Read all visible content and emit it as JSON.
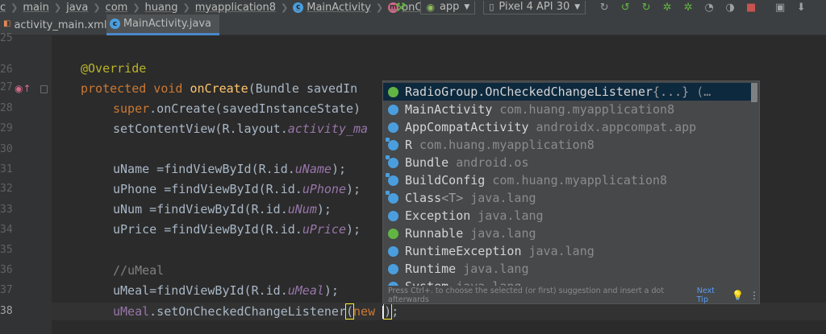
{
  "breadcrumb": [
    "c",
    "main",
    "java",
    "com",
    "huang",
    "myapplication8",
    "MainActivity",
    "onCreate"
  ],
  "toolbar": {
    "run_config": "app",
    "device": "Pixel 4 API 30",
    "icons": [
      "hammer-icon",
      "android-icon",
      "device-icon",
      "run-icon",
      "rerun-icon",
      "apply-changes-icon",
      "debug-icon",
      "attach-debugger-icon",
      "profile-icon",
      "coverage-icon",
      "stop-icon",
      "sdk-manager-icon",
      "avd-manager-icon"
    ]
  },
  "tabs": [
    {
      "label": "activity_main.xml",
      "active": false
    },
    {
      "label": "MainActivity.java",
      "active": true
    }
  ],
  "line_numbers": [
    "25",
    "26",
    "27",
    "28",
    "29",
    "30",
    "31",
    "32",
    "33",
    "34",
    "35",
    "36",
    "37",
    "38"
  ],
  "code": {
    "l26_ann": "@Override",
    "l27_kw": "protected void",
    "l27_fn": "onCreate",
    "l27_rest": "(Bundle savedIn",
    "l28_kw": "super",
    "l28_rest": ".onCreate(savedInstanceState)",
    "l29_a": "setContentView(R.layout.",
    "l29_b": "activity_ma",
    "l31_a": "uName =findViewById(R.id.",
    "l31_b": "uName",
    "l31_c": ");",
    "l32_a": "uPhone =findViewById(R.id.",
    "l32_b": "uPhone",
    "l32_c": ");",
    "l33_a": "uNum =findViewById(R.id.",
    "l33_b": "uNum",
    "l33_c": ");",
    "l34_a": "uPrice =findViewById(R.id.",
    "l34_b": "uPrice",
    "l34_c": ");",
    "l36_comment": "//uMeal",
    "l37_a": "uMeal=findViewById(R.id.",
    "l37_b": "uMeal",
    "l37_c": ");",
    "l38_a": "uMeal",
    "l38_b": ".setOnCheckedChangeListener",
    "l38_paren_open": "(",
    "l38_new": "new ",
    "l38_paren_close": ")",
    "l38_end": ";"
  },
  "completion": {
    "items": [
      {
        "name": "RadioGroup.OnCheckedChangeListener",
        "generic": "{...}",
        "pkg": "(…",
        "icon": "interface-icon"
      },
      {
        "name": "MainActivity",
        "generic": "",
        "pkg": "com.huang.myapplication8",
        "icon": "class-icon"
      },
      {
        "name": "AppCompatActivity",
        "generic": "",
        "pkg": "androidx.appcompat.app",
        "icon": "class-icon"
      },
      {
        "name": "R",
        "generic": "",
        "pkg": "com.huang.myapplication8",
        "icon": "class-icon"
      },
      {
        "name": "Bundle",
        "generic": "",
        "pkg": "android.os",
        "icon": "class-icon"
      },
      {
        "name": "BuildConfig",
        "generic": "",
        "pkg": "com.huang.myapplication8",
        "icon": "class-icon"
      },
      {
        "name": "Class",
        "generic": "<T>",
        "pkg": "java.lang",
        "icon": "class-icon"
      },
      {
        "name": "Exception",
        "generic": "",
        "pkg": "java.lang",
        "icon": "class-icon"
      },
      {
        "name": "Runnable",
        "generic": "",
        "pkg": "java.lang",
        "icon": "interface-icon"
      },
      {
        "name": "RuntimeException",
        "generic": "",
        "pkg": "java.lang",
        "icon": "class-icon"
      },
      {
        "name": "Runtime",
        "generic": "",
        "pkg": "java.lang",
        "icon": "class-icon"
      },
      {
        "name": "System",
        "generic": "",
        "pkg": "java.lang",
        "icon": "class-icon"
      }
    ],
    "footer_text": "Press Ctrl+. to choose the selected (or first) suggestion and insert a dot afterwards",
    "next_tip": "Next Tip"
  }
}
